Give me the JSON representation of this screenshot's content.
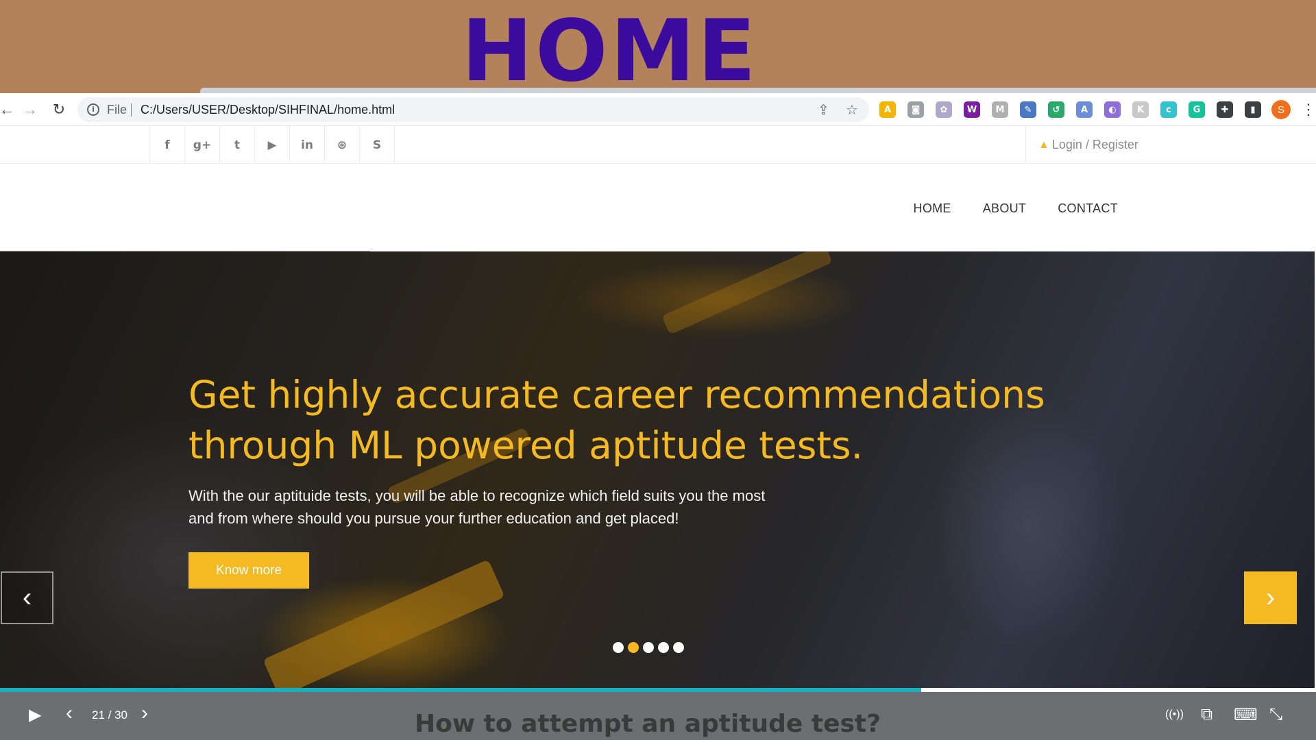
{
  "slide": {
    "title": "HOME"
  },
  "browser": {
    "back_icon": "←",
    "forward_icon": "→",
    "reload_icon": "↻",
    "info_icon": "i",
    "scheme_label": "File",
    "url": "C:/Users/USER/Desktop/SIHFINAL/home.html",
    "share_icon": "⇪",
    "bookmark_icon": "☆",
    "profile_initial": "S",
    "extensions": [
      {
        "name": "warning-extension-icon",
        "glyph": "A",
        "color": "#f4b400"
      },
      {
        "name": "camera-extension-icon",
        "glyph": "◙",
        "color": "#9aa0a6"
      },
      {
        "name": "gear-extension-icon",
        "glyph": "✿",
        "color": "#b0a7c9"
      },
      {
        "name": "w-extension-icon",
        "glyph": "W",
        "color": "#7b1fa2"
      },
      {
        "name": "m-extension-icon",
        "glyph": "M",
        "color": "#b0b0b0"
      },
      {
        "name": "edit-extension-icon",
        "glyph": "✎",
        "color": "#4a78c2"
      },
      {
        "name": "undo-extension-icon",
        "glyph": "↺",
        "color": "#2aa96a"
      },
      {
        "name": "translate-extension-icon",
        "glyph": "A",
        "color": "#6a8fd6"
      },
      {
        "name": "a-extension-icon",
        "glyph": "◐",
        "color": "#8e6fd8"
      },
      {
        "name": "k-extension-icon",
        "glyph": "K",
        "color": "#c9c9c9"
      },
      {
        "name": "c-extension-icon",
        "glyph": "c",
        "color": "#35c2cf"
      },
      {
        "name": "grammarly-extension-icon",
        "glyph": "G",
        "color": "#15c39a"
      },
      {
        "name": "puzzle-extension-icon",
        "glyph": "✚",
        "color": "#3c4043"
      },
      {
        "name": "sidepanel-extension-icon",
        "glyph": "▮",
        "color": "#3c4043"
      }
    ],
    "menu_icon": "⋮"
  },
  "topbar": {
    "social": [
      {
        "name": "facebook-icon",
        "glyph": "f"
      },
      {
        "name": "google-plus-icon",
        "glyph": "g+"
      },
      {
        "name": "twitter-icon",
        "glyph": "t"
      },
      {
        "name": "youtube-icon",
        "glyph": "▶"
      },
      {
        "name": "linkedin-icon",
        "glyph": "in"
      },
      {
        "name": "dribbble-icon",
        "glyph": "⊛"
      },
      {
        "name": "skype-icon",
        "glyph": "S"
      }
    ],
    "login_icon": "▲",
    "login_label": "Login / Register"
  },
  "nav": {
    "items": [
      "HOME",
      "ABOUT",
      "CONTACT"
    ]
  },
  "hero": {
    "title": "Get highly accurate career recommendations through ML powered aptitude tests.",
    "description": "With the our aptituide tests, you will be able to recognize which field suits you the most and from where should you pursue your further education and get placed!",
    "button_label": "Know more",
    "prev_icon": "‹",
    "next_icon": "›",
    "dots_count": 5,
    "active_dot": 1,
    "accent_color": "#f5b921"
  },
  "viewer": {
    "play_icon": "▶",
    "prev_icon": "‹",
    "next_icon": "›",
    "counter": "21 / 30",
    "progress": 0.7,
    "next_slide_title": "How to attempt an aptitude test?",
    "broadcast_icon": "((•))",
    "window_icon": "⧉",
    "keyboard_icon": "⌨",
    "exit_fullscreen_icon": "⤡"
  }
}
